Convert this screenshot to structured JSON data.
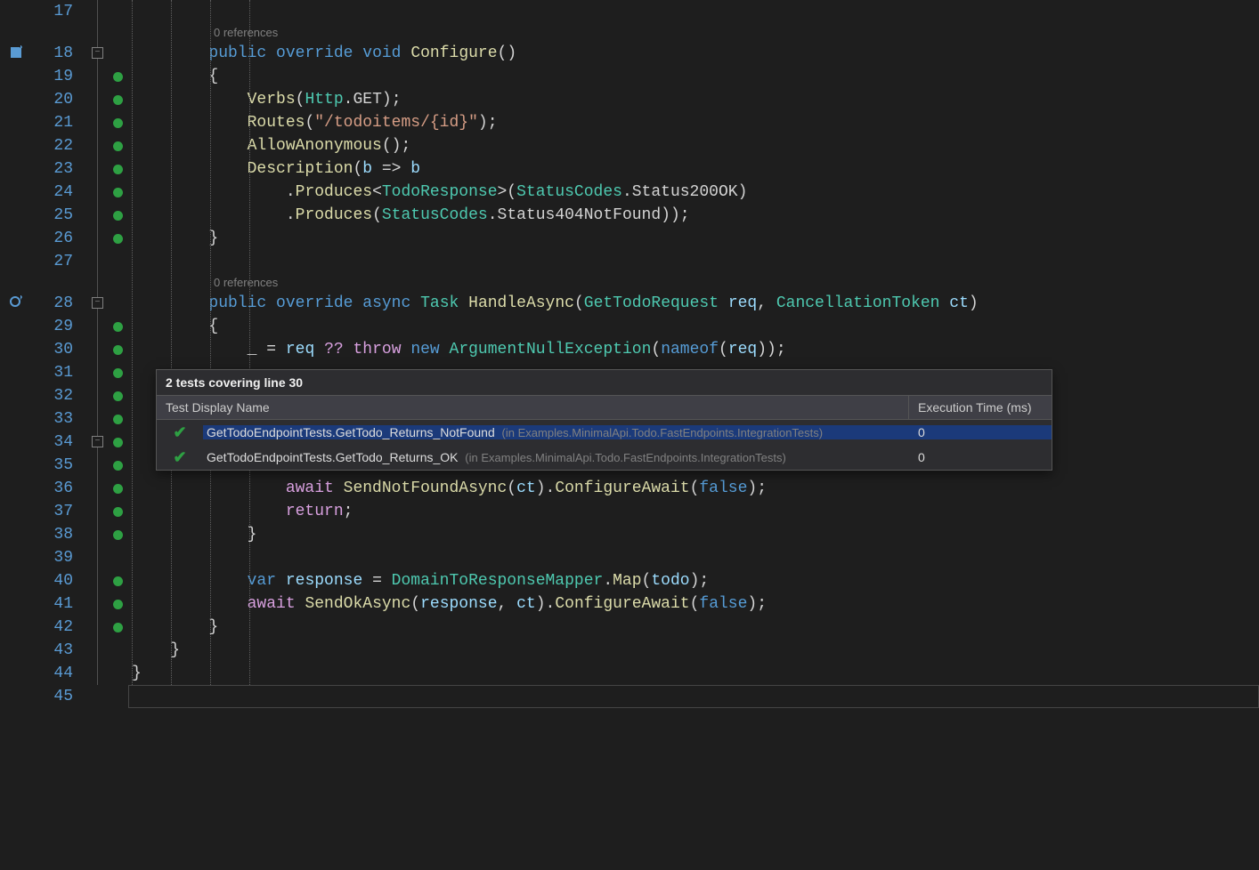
{
  "line_start": 17,
  "line_end": 45,
  "glyphs": [
    {
      "line": 18,
      "icon": "save-icon"
    },
    {
      "line": 28,
      "icon": "lens-icon"
    }
  ],
  "folds": [
    {
      "line": 18,
      "state": "-"
    },
    {
      "line": 28,
      "state": "-"
    },
    {
      "line": 34,
      "state": "-"
    }
  ],
  "coverage_lines": [
    19,
    20,
    21,
    22,
    23,
    24,
    25,
    26,
    29,
    30,
    31,
    32,
    33,
    34,
    35,
    36,
    37,
    38,
    40,
    41,
    42
  ],
  "codelens": {
    "configure": "0 references",
    "handle": "0 references"
  },
  "code": {
    "l18": [
      {
        "t": "public",
        "c": "kw"
      },
      {
        "t": " "
      },
      {
        "t": "override",
        "c": "kw"
      },
      {
        "t": " "
      },
      {
        "t": "void",
        "c": "kw"
      },
      {
        "t": " "
      },
      {
        "t": "Configure",
        "c": "method"
      },
      {
        "t": "()",
        "c": "punct"
      }
    ],
    "l19": [
      {
        "t": "{",
        "c": "punct"
      }
    ],
    "l20": [
      {
        "t": "Verbs",
        "c": "method"
      },
      {
        "t": "(",
        "c": "punct"
      },
      {
        "t": "Http",
        "c": "type"
      },
      {
        "t": ".",
        "c": "punct"
      },
      {
        "t": "GET",
        "c": "field"
      },
      {
        "t": ");",
        "c": "punct"
      }
    ],
    "l21": [
      {
        "t": "Routes",
        "c": "method"
      },
      {
        "t": "(",
        "c": "punct"
      },
      {
        "t": "\"/todoitems/{id}\"",
        "c": "str"
      },
      {
        "t": ");",
        "c": "punct"
      }
    ],
    "l22": [
      {
        "t": "AllowAnonymous",
        "c": "method"
      },
      {
        "t": "();",
        "c": "punct"
      }
    ],
    "l23": [
      {
        "t": "Description",
        "c": "method"
      },
      {
        "t": "(",
        "c": "punct"
      },
      {
        "t": "b",
        "c": "param"
      },
      {
        "t": " => ",
        "c": "op"
      },
      {
        "t": "b",
        "c": "param"
      }
    ],
    "l24": [
      {
        "t": ".",
        "c": "punct"
      },
      {
        "t": "Produces",
        "c": "method"
      },
      {
        "t": "<",
        "c": "punct"
      },
      {
        "t": "TodoResponse",
        "c": "type"
      },
      {
        "t": ">(",
        "c": "punct"
      },
      {
        "t": "StatusCodes",
        "c": "type"
      },
      {
        "t": ".",
        "c": "punct"
      },
      {
        "t": "Status200OK",
        "c": "field"
      },
      {
        "t": ")",
        "c": "punct"
      }
    ],
    "l25": [
      {
        "t": ".",
        "c": "punct"
      },
      {
        "t": "Produces",
        "c": "method"
      },
      {
        "t": "(",
        "c": "punct"
      },
      {
        "t": "StatusCodes",
        "c": "type"
      },
      {
        "t": ".",
        "c": "punct"
      },
      {
        "t": "Status404NotFound",
        "c": "field"
      },
      {
        "t": "));",
        "c": "punct"
      }
    ],
    "l26": [
      {
        "t": "}",
        "c": "punct"
      }
    ],
    "l28": [
      {
        "t": "public",
        "c": "kw"
      },
      {
        "t": " "
      },
      {
        "t": "override",
        "c": "kw"
      },
      {
        "t": " "
      },
      {
        "t": "async",
        "c": "kw"
      },
      {
        "t": " "
      },
      {
        "t": "Task",
        "c": "type"
      },
      {
        "t": " "
      },
      {
        "t": "HandleAsync",
        "c": "method"
      },
      {
        "t": "(",
        "c": "punct"
      },
      {
        "t": "GetTodoRequest",
        "c": "type"
      },
      {
        "t": " "
      },
      {
        "t": "req",
        "c": "param"
      },
      {
        "t": ", ",
        "c": "punct"
      },
      {
        "t": "CancellationToken",
        "c": "type"
      },
      {
        "t": " "
      },
      {
        "t": "ct",
        "c": "param"
      },
      {
        "t": ")",
        "c": "punct"
      }
    ],
    "l29": [
      {
        "t": "{",
        "c": "punct"
      }
    ],
    "l30": [
      {
        "t": "_",
        "c": "discard"
      },
      {
        "t": " = ",
        "c": "op"
      },
      {
        "t": "req",
        "c": "param"
      },
      {
        "t": " "
      },
      {
        "t": "??",
        "c": "ctrl"
      },
      {
        "t": " "
      },
      {
        "t": "throw",
        "c": "ctrl"
      },
      {
        "t": " "
      },
      {
        "t": "new",
        "c": "kw"
      },
      {
        "t": " "
      },
      {
        "t": "ArgumentNullException",
        "c": "type"
      },
      {
        "t": "(",
        "c": "punct"
      },
      {
        "t": "nameof",
        "c": "kw"
      },
      {
        "t": "(",
        "c": "punct"
      },
      {
        "t": "req",
        "c": "param"
      },
      {
        "t": "));",
        "c": "punct"
      }
    ],
    "l36": [
      {
        "t": "await",
        "c": "ctrl"
      },
      {
        "t": " "
      },
      {
        "t": "SendNotFoundAsync",
        "c": "method"
      },
      {
        "t": "(",
        "c": "punct"
      },
      {
        "t": "ct",
        "c": "param"
      },
      {
        "t": ").",
        "c": "punct"
      },
      {
        "t": "ConfigureAwait",
        "c": "method"
      },
      {
        "t": "(",
        "c": "punct"
      },
      {
        "t": "false",
        "c": "boolkw"
      },
      {
        "t": ");",
        "c": "punct"
      }
    ],
    "l37": [
      {
        "t": "return",
        "c": "ctrl"
      },
      {
        "t": ";",
        "c": "punct"
      }
    ],
    "l38": [
      {
        "t": "}",
        "c": "punct"
      }
    ],
    "l40": [
      {
        "t": "var",
        "c": "kw"
      },
      {
        "t": " "
      },
      {
        "t": "response",
        "c": "param"
      },
      {
        "t": " = ",
        "c": "op"
      },
      {
        "t": "DomainToResponseMapper",
        "c": "type"
      },
      {
        "t": ".",
        "c": "punct"
      },
      {
        "t": "Map",
        "c": "method"
      },
      {
        "t": "(",
        "c": "punct"
      },
      {
        "t": "todo",
        "c": "param"
      },
      {
        "t": ");",
        "c": "punct"
      }
    ],
    "l41": [
      {
        "t": "await",
        "c": "ctrl"
      },
      {
        "t": " "
      },
      {
        "t": "SendOkAsync",
        "c": "method"
      },
      {
        "t": "(",
        "c": "punct"
      },
      {
        "t": "response",
        "c": "param"
      },
      {
        "t": ", ",
        "c": "punct"
      },
      {
        "t": "ct",
        "c": "param"
      },
      {
        "t": ").",
        "c": "punct"
      },
      {
        "t": "ConfigureAwait",
        "c": "method"
      },
      {
        "t": "(",
        "c": "punct"
      },
      {
        "t": "false",
        "c": "boolkw"
      },
      {
        "t": ");",
        "c": "punct"
      }
    ],
    "l42": [
      {
        "t": "}",
        "c": "punct"
      }
    ],
    "l43": [
      {
        "t": "}",
        "c": "punct"
      }
    ],
    "l44": [
      {
        "t": "}",
        "c": "punct"
      }
    ]
  },
  "indents": {
    "l18": 2,
    "l19": 2,
    "l20": 3,
    "l21": 3,
    "l22": 3,
    "l23": 3,
    "l24": 4,
    "l25": 4,
    "l26": 2,
    "l28": 2,
    "l29": 2,
    "l30": 3,
    "l36": 4,
    "l37": 4,
    "l38": 3,
    "l40": 3,
    "l41": 3,
    "l42": 2,
    "l43": 1,
    "l44": 0
  },
  "tooltip": {
    "title": "2 tests covering line 30",
    "header_name": "Test Display Name",
    "header_time": "Execution Time (ms)",
    "rows": [
      {
        "status": "pass",
        "name": "GetTodoEndpointTests.GetTodo_Returns_NotFound",
        "assembly": "(in Examples.MinimalApi.Todo.FastEndpoints.IntegrationTests)",
        "time": "0",
        "selected": true
      },
      {
        "status": "pass",
        "name": "GetTodoEndpointTests.GetTodo_Returns_OK",
        "assembly": "(in Examples.MinimalApi.Todo.FastEndpoints.IntegrationTests)",
        "time": "0",
        "selected": false
      }
    ]
  }
}
